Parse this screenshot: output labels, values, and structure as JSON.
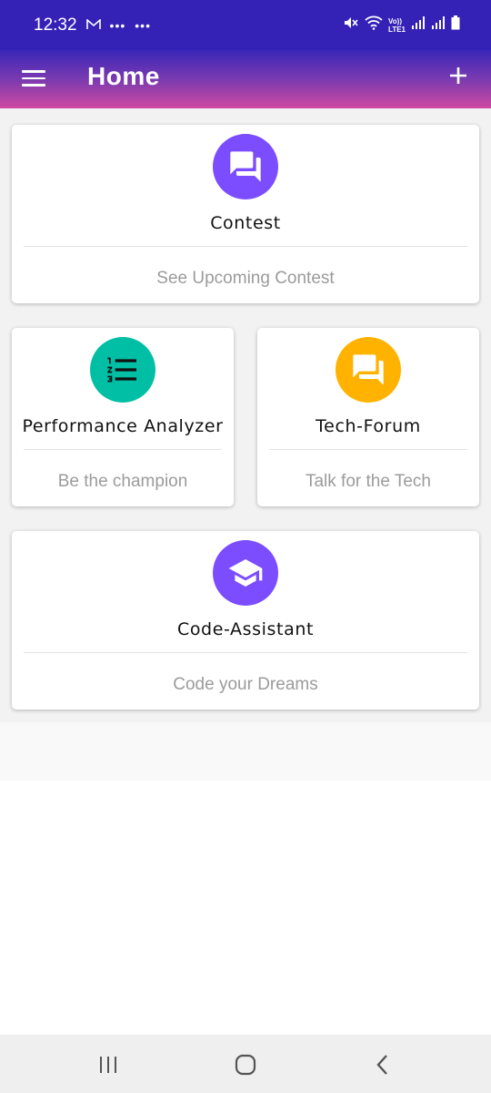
{
  "status_bar": {
    "time": "12:32",
    "notification_icons": [
      "gmail-icon",
      "more-dots",
      "more-dots"
    ],
    "system_icons": [
      "mute-icon",
      "wifi-icon",
      "volte-icon",
      "signal-icon",
      "signal-icon",
      "battery-icon"
    ],
    "volte_label": "Vo))",
    "lte_label": "LTE1"
  },
  "app_bar": {
    "title": "Home",
    "menu_icon": "hamburger-menu-icon",
    "add_icon": "plus-icon"
  },
  "cards": [
    {
      "id": "contest",
      "title": "Contest",
      "subtitle": "See Upcoming Contest",
      "icon": "chat-bubbles-icon",
      "color": "#7c4dff"
    },
    {
      "id": "performance",
      "title": "Performance Analyzer",
      "subtitle": "Be the champion",
      "icon": "numbered-list-icon",
      "color": "#00bfa5"
    },
    {
      "id": "tech-forum",
      "title": "Tech-Forum",
      "subtitle": "Talk for the Tech",
      "icon": "chat-bubbles-icon",
      "color": "#ffb300"
    },
    {
      "id": "code-assistant",
      "title": "Code-Assistant",
      "subtitle": "Code your Dreams",
      "icon": "graduation-cap-icon",
      "color": "#7c4dff"
    }
  ],
  "nav_bar": {
    "items": [
      "recent-apps-icon",
      "home-icon",
      "back-icon"
    ]
  },
  "colors": {
    "status_bar": "#3422b7",
    "app_bar_start": "#3a26b8",
    "app_bar_end": "#cf4aa2",
    "content_bg": "#f2f2f2",
    "subtitle": "#9b9b9b"
  }
}
